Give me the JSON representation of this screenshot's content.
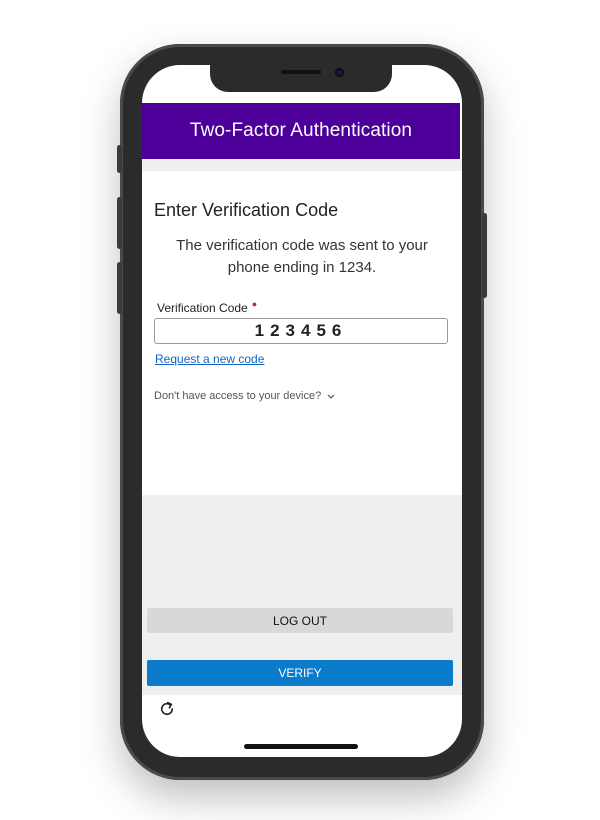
{
  "header": {
    "title": "Two-Factor Authentication"
  },
  "main": {
    "heading": "Enter Verification Code",
    "message": "The verification code was sent to your phone ending in 1234.",
    "code_field": {
      "label": "Verification Code",
      "value": "123456"
    },
    "request_link": "Request a new code",
    "access_question": "Don't have access to your device?"
  },
  "footer": {
    "logout_label": "LOG OUT",
    "verify_label": "VERIFY"
  },
  "icons": {
    "refresh": "refresh-icon",
    "chevron": "chevron-down-icon",
    "required": "required-indicator"
  },
  "colors": {
    "header_bg": "#4c0099",
    "verify_bg": "#0b7ccc",
    "link": "#1565c0",
    "required": "#c62828"
  }
}
